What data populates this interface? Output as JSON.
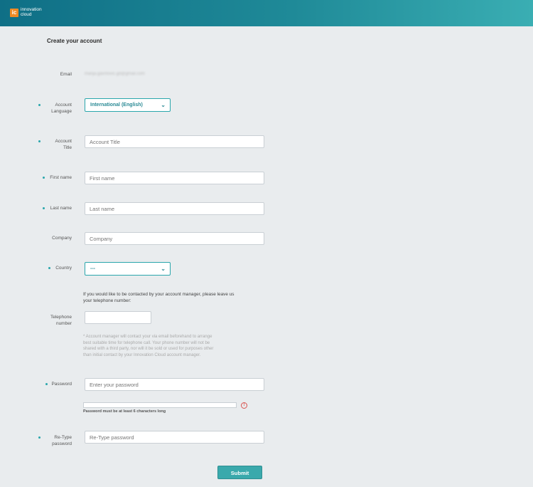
{
  "header": {
    "logo_mark": "ic",
    "logo_line1": "innovation",
    "logo_line2": "cloud"
  },
  "form": {
    "title": "Create your account",
    "email": {
      "label": "Email",
      "value": "marija.gavrilovic.gd@gmail.com"
    },
    "account_language": {
      "label_line1": "Account",
      "label_line2": "Language",
      "value": "International (English)"
    },
    "account_title": {
      "label_line1": "Account",
      "label_line2": "Title",
      "placeholder": "Account Title"
    },
    "first_name": {
      "label": "First name",
      "placeholder": "First name"
    },
    "last_name": {
      "label": "Last name",
      "placeholder": "Last name"
    },
    "company": {
      "label": "Company",
      "placeholder": "Company"
    },
    "country": {
      "label": "Country",
      "value": "---"
    },
    "telephone": {
      "intro_line1": "If you would like to be contacted by your account manager, please leave us",
      "intro_line2": "your telephone number:",
      "label_line1": "Telephone",
      "label_line2": "number",
      "note_line1": "* Account manager will contact your via email beforehand to arrange",
      "note_line2": "best suitable time for telephone call. Your phone number will not be",
      "note_line3": "shared with a third party, nor will it be sold or used for purposes other",
      "note_line4": "than initial contact by your Innovation Cloud account manager."
    },
    "password": {
      "label": "Password",
      "placeholder": "Enter your password",
      "hint": "Password must be at least 6 characters long",
      "warning_icon": "!"
    },
    "retype_password": {
      "label_line1": "Re-Type",
      "label_line2": "password",
      "placeholder": "Re-Type password"
    },
    "submit_label": "Submit"
  },
  "colors": {
    "header_start": "#0f6f86",
    "header_end": "#3aaeb3",
    "accent": "#2aa6ac",
    "logo": "#f08a24",
    "background": "#e9ecee"
  },
  "icons": {
    "chevron": "chevron-down-icon",
    "warning": "warning-icon"
  }
}
